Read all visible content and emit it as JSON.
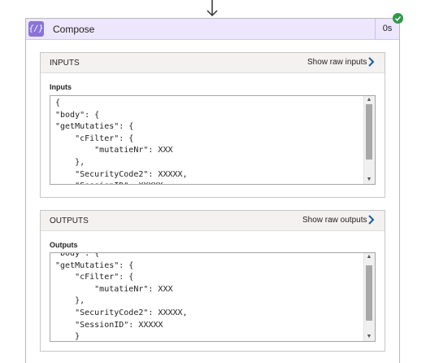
{
  "action": {
    "icon": "compose-icon",
    "icon_glyph": "{∕}",
    "title": "Compose",
    "duration": "0s",
    "status": "succeeded",
    "status_icon": "success-check-icon",
    "status_color": "#2e9a47",
    "accent_color": "#8b73d8",
    "header_color": "#ece7fd"
  },
  "inputs": {
    "header": "INPUTS",
    "raw_link": "Show raw inputs",
    "field_label": "Inputs",
    "scroll_fraction": 0.0,
    "lines": [
      "{",
      "\"body\": {",
      "\"getMutaties\": {",
      "    \"cFilter\": {",
      "        \"mutatieNr\": XXX",
      "    },",
      "    \"SecurityCode2\": XXXXX,",
      "    \"SessionID\": XXXXX"
    ]
  },
  "outputs": {
    "header": "OUTPUTS",
    "raw_link": "Show raw outputs",
    "field_label": "Outputs",
    "scroll_fraction": 0.25,
    "lines": [
      "\"body\": {",
      "\"getMutaties\": {",
      "    \"cFilter\": {",
      "        \"mutatieNr\": XXX",
      "    },",
      "    \"SecurityCode2\": XXXXX,",
      "    \"SessionID\": XXXXX",
      "    }"
    ]
  }
}
